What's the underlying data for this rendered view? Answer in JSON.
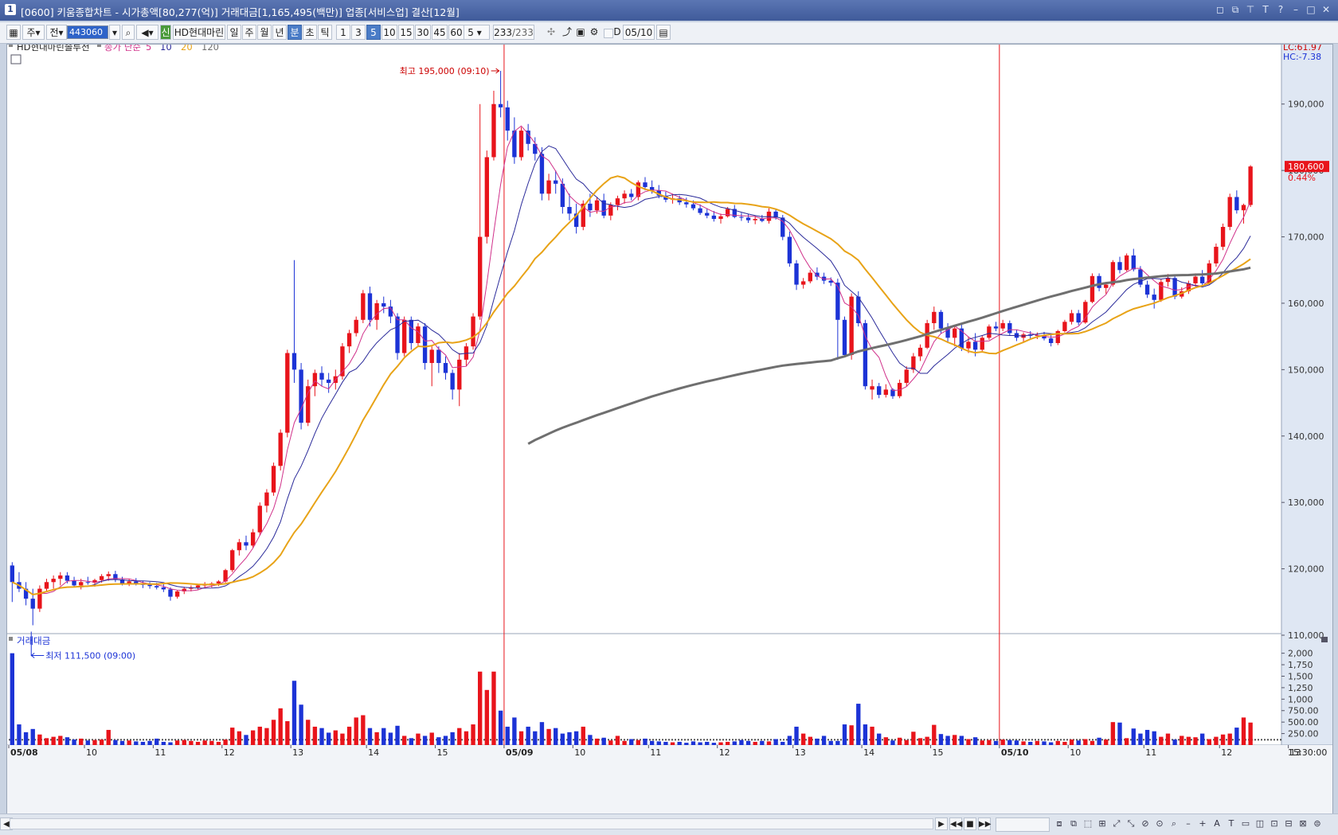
{
  "window": {
    "title": "[0600] 키움종합차트 - 시가총액[80,277(억)] 거래대금[1,165,495(백만)] 업종[서비스업] 결산[12월]",
    "icon_label": "1",
    "controls": [
      "restore-down-icon",
      "restore-icon",
      "pin-icon",
      "font-icon",
      "help-icon",
      "minimize-icon",
      "maximize-icon",
      "close-icon"
    ],
    "control_glyphs": [
      "◻",
      "⧉",
      "⊤",
      "T",
      "?",
      "–",
      "□",
      "✕"
    ]
  },
  "toolbar": {
    "type_select": "주",
    "market_select": "전",
    "code_value": "443060",
    "stock_name": "HD현대마린",
    "periods": [
      "일",
      "주",
      "월",
      "년",
      "분",
      "초",
      "틱"
    ],
    "period_selected": "분",
    "intervals": [
      "1",
      "3",
      "5",
      "10",
      "15",
      "30",
      "45",
      "60"
    ],
    "interval_selected": "5",
    "interval_combo": "5",
    "count_value": "233",
    "count_total": "/233",
    "date_value": "05/10"
  },
  "legend": {
    "stock": "HD현대마린솔루션",
    "ma_prefix": "종가 단순",
    "ma_periods": [
      "5",
      "10",
      "20",
      "120"
    ],
    "ma_colors": [
      "#d0308a",
      "#2a2a9a",
      "#e8a317",
      "#6f6f6f"
    ]
  },
  "indicators": {
    "lc": "LC:61.97",
    "hc": "HC:-7.38"
  },
  "price_tag": {
    "value": "180,600",
    "change": "0.44%"
  },
  "annotations": {
    "high": "최고 195,000 (09:10)",
    "low": "최저 111,500 (09:00)"
  },
  "volume_panel": {
    "label": "거래대금"
  },
  "time_readout": "15:30:00",
  "colors": {
    "up": "#e8141b",
    "down": "#1c33d6",
    "ma5": "#d0308a",
    "ma10": "#2a2a9a",
    "ma20": "#e8a317",
    "ma120": "#6f6f6f",
    "divider": "#e8141b"
  },
  "chart_data": {
    "type": "candlestick",
    "interval": "5분",
    "price_axis_ticks": [
      "190,000",
      "180,000",
      "170,000",
      "160,000",
      "150,000",
      "140,000",
      "130,000",
      "120,000",
      "110,000"
    ],
    "price_ylim": [
      110000,
      198000
    ],
    "volume_axis_ticks": [
      "2,000",
      "1,750",
      "1,500",
      "1,250",
      "1,000",
      "750.00",
      "500.00",
      "250.00"
    ],
    "volume_ylim": [
      0,
      2150
    ],
    "days": [
      "05/08",
      "05/09",
      "05/10"
    ],
    "x_tick_labels": [
      "05/08",
      "10",
      "11",
      "12",
      "13",
      "14",
      "15",
      "05/09",
      "10",
      "11",
      "12",
      "13",
      "14",
      "15",
      "05/10",
      "10",
      "11",
      "12",
      "13",
      "14",
      "15"
    ],
    "x_tick_index": [
      0,
      11,
      21,
      31,
      41,
      52,
      62,
      72,
      82,
      93,
      103,
      114,
      124,
      134,
      144,
      154,
      165,
      176,
      186,
      197,
      207
    ],
    "ohlc": [
      [
        120500,
        121000,
        115000,
        118000
      ],
      [
        118000,
        119500,
        116500,
        117000
      ],
      [
        117000,
        118000,
        114500,
        115500
      ],
      [
        115500,
        117000,
        111500,
        114000
      ],
      [
        114000,
        117500,
        113500,
        117000
      ],
      [
        117000,
        118500,
        116500,
        118000
      ],
      [
        118000,
        119000,
        117000,
        118500
      ],
      [
        118500,
        119500,
        117500,
        119000
      ],
      [
        119000,
        119500,
        117800,
        118200
      ],
      [
        118200,
        118800,
        117200,
        117500
      ],
      [
        117500,
        118500,
        116900,
        118000
      ],
      [
        118000,
        118800,
        117600,
        117900
      ],
      [
        117900,
        118500,
        117300,
        118300
      ],
      [
        118300,
        119200,
        117900,
        118900
      ],
      [
        118900,
        119600,
        118200,
        119200
      ],
      [
        119200,
        119700,
        118000,
        118400
      ],
      [
        118400,
        118800,
        117500,
        117800
      ],
      [
        117800,
        118500,
        117400,
        118100
      ],
      [
        118100,
        118600,
        117500,
        117700
      ],
      [
        117700,
        118200,
        117100,
        117600
      ],
      [
        117600,
        118000,
        117000,
        117400
      ],
      [
        117400,
        117900,
        116900,
        117200
      ],
      [
        117200,
        117700,
        116500,
        116900
      ],
      [
        116900,
        117200,
        115200,
        115800
      ],
      [
        115800,
        116800,
        115500,
        116600
      ],
      [
        116600,
        117300,
        116200,
        117000
      ],
      [
        117000,
        117500,
        116600,
        117200
      ],
      [
        117200,
        117700,
        116900,
        117500
      ],
      [
        117500,
        118000,
        117100,
        117600
      ],
      [
        117600,
        118000,
        117200,
        117800
      ],
      [
        117800,
        118300,
        117400,
        118100
      ],
      [
        118100,
        120000,
        117900,
        119800
      ],
      [
        119800,
        123000,
        119500,
        122800
      ],
      [
        122800,
        124500,
        122000,
        124000
      ],
      [
        124000,
        125000,
        122800,
        123500
      ],
      [
        123500,
        126000,
        123200,
        125500
      ],
      [
        125500,
        130000,
        125000,
        129500
      ],
      [
        129500,
        132000,
        128500,
        131500
      ],
      [
        131500,
        136000,
        131000,
        135500
      ],
      [
        135500,
        141000,
        134800,
        140500
      ],
      [
        140500,
        153000,
        139800,
        152500
      ],
      [
        152500,
        166500,
        148000,
        150000
      ],
      [
        150000,
        151000,
        141000,
        142000
      ],
      [
        142000,
        148500,
        141500,
        147500
      ],
      [
        147500,
        150000,
        146000,
        149500
      ],
      [
        149500,
        150500,
        147500,
        148500
      ],
      [
        148500,
        149500,
        146500,
        148000
      ],
      [
        148000,
        150000,
        147000,
        149000
      ],
      [
        149000,
        154000,
        148500,
        153500
      ],
      [
        153500,
        156000,
        152500,
        155500
      ],
      [
        155500,
        158000,
        155000,
        157500
      ],
      [
        157500,
        162000,
        157000,
        161500
      ],
      [
        161500,
        162500,
        156500,
        157500
      ],
      [
        157500,
        160500,
        156000,
        160000
      ],
      [
        160000,
        161000,
        158500,
        159500
      ],
      [
        159500,
        160500,
        157000,
        158000
      ],
      [
        158000,
        158500,
        151500,
        152500
      ],
      [
        152500,
        158000,
        152000,
        157500
      ],
      [
        157500,
        158000,
        153000,
        154000
      ],
      [
        154000,
        157000,
        153500,
        156500
      ],
      [
        156500,
        157000,
        150000,
        151000
      ],
      [
        151000,
        153500,
        147500,
        153000
      ],
      [
        153000,
        153500,
        149500,
        151000
      ],
      [
        151000,
        152000,
        148500,
        149500
      ],
      [
        149500,
        150000,
        145500,
        147000
      ],
      [
        147000,
        152500,
        144500,
        151500
      ],
      [
        151500,
        154000,
        150500,
        153500
      ],
      [
        153500,
        158500,
        153000,
        158000
      ],
      [
        158000,
        190000,
        157500,
        170000
      ],
      [
        170000,
        183000,
        169000,
        182000
      ],
      [
        182000,
        192000,
        181500,
        190000
      ],
      [
        190000,
        195000,
        188000,
        189500
      ],
      [
        189500,
        190500,
        184500,
        186000
      ],
      [
        186000,
        188000,
        181000,
        182000
      ],
      [
        182000,
        186500,
        181500,
        186000
      ],
      [
        186000,
        187000,
        183000,
        184000
      ],
      [
        184000,
        185000,
        181500,
        182500
      ],
      [
        182500,
        183500,
        175500,
        176500
      ],
      [
        176500,
        179500,
        175500,
        178500
      ],
      [
        178500,
        180000,
        176500,
        178000
      ],
      [
        178000,
        178800,
        173500,
        174500
      ],
      [
        174500,
        176500,
        172500,
        173500
      ],
      [
        173500,
        175000,
        170500,
        171500
      ],
      [
        171500,
        175500,
        171000,
        175000
      ],
      [
        175000,
        176500,
        173000,
        174000
      ],
      [
        174000,
        176000,
        173500,
        175500
      ],
      [
        175500,
        176500,
        172800,
        173200
      ],
      [
        173200,
        175200,
        172500,
        174800
      ],
      [
        174800,
        176200,
        174000,
        175800
      ],
      [
        175800,
        177000,
        175000,
        176500
      ],
      [
        176500,
        177200,
        175500,
        176000
      ],
      [
        176000,
        178500,
        175500,
        178200
      ],
      [
        178200,
        179000,
        177000,
        177500
      ],
      [
        177500,
        178500,
        176500,
        177000
      ],
      [
        177000,
        177800,
        175800,
        176200
      ],
      [
        176200,
        176800,
        175200,
        175600
      ],
      [
        175600,
        176500,
        175000,
        175800
      ],
      [
        175800,
        176200,
        174800,
        175200
      ],
      [
        175200,
        175900,
        174400,
        174900
      ],
      [
        174900,
        175500,
        174000,
        174300
      ],
      [
        174300,
        174900,
        173300,
        173600
      ],
      [
        173600,
        174300,
        172800,
        173200
      ],
      [
        173200,
        173900,
        172300,
        172700
      ],
      [
        172700,
        173500,
        172000,
        173100
      ],
      [
        173100,
        174500,
        172900,
        174200
      ],
      [
        174200,
        174800,
        172800,
        173000
      ],
      [
        173000,
        173600,
        172400,
        172900
      ],
      [
        172900,
        173400,
        172100,
        172500
      ],
      [
        172500,
        173200,
        171900,
        172700
      ],
      [
        172700,
        173300,
        172200,
        172400
      ],
      [
        172400,
        174300,
        172000,
        173800
      ],
      [
        173800,
        174200,
        172600,
        172900
      ],
      [
        172900,
        173300,
        169500,
        170000
      ],
      [
        170000,
        170800,
        165500,
        166000
      ],
      [
        166000,
        166500,
        162000,
        162800
      ],
      [
        162800,
        163800,
        162200,
        163300
      ],
      [
        163300,
        165000,
        163000,
        164600
      ],
      [
        164600,
        165400,
        163500,
        164000
      ],
      [
        164000,
        164600,
        162900,
        163400
      ],
      [
        163400,
        163900,
        162600,
        163100
      ],
      [
        163100,
        163700,
        151500,
        157500
      ],
      [
        157500,
        158000,
        152000,
        152200
      ],
      [
        152200,
        161500,
        151500,
        161000
      ],
      [
        161000,
        161800,
        156500,
        157000
      ],
      [
        157000,
        157500,
        147000,
        147500
      ],
      [
        147000,
        148500,
        145500,
        147500
      ],
      [
        147500,
        148000,
        145700,
        146200
      ],
      [
        146200,
        147800,
        145800,
        147000
      ],
      [
        147000,
        147200,
        145600,
        146000
      ],
      [
        146000,
        148500,
        145700,
        148000
      ],
      [
        148000,
        150500,
        147500,
        150000
      ],
      [
        150000,
        152500,
        149500,
        152000
      ],
      [
        152000,
        153800,
        151300,
        153300
      ],
      [
        153300,
        157500,
        153100,
        157000
      ],
      [
        157000,
        159500,
        156000,
        158700
      ],
      [
        158700,
        159000,
        155500,
        156200
      ],
      [
        156200,
        157000,
        154000,
        154800
      ],
      [
        154800,
        156600,
        153500,
        156200
      ],
      [
        156200,
        157000,
        152800,
        153200
      ],
      [
        153200,
        155000,
        152500,
        154200
      ],
      [
        154200,
        155500,
        152000,
        153000
      ],
      [
        153000,
        155200,
        152800,
        154800
      ],
      [
        154800,
        156800,
        154500,
        156500
      ],
      [
        156500,
        157200,
        155800,
        156200
      ],
      [
        156200,
        157500,
        155800,
        157000
      ],
      [
        157000,
        157400,
        155200,
        155500
      ],
      [
        155500,
        156000,
        154300,
        154800
      ],
      [
        154800,
        155600,
        154200,
        155300
      ],
      [
        155300,
        155800,
        154700,
        155100
      ],
      [
        155100,
        155600,
        154600,
        155200
      ],
      [
        155200,
        155700,
        154400,
        154700
      ],
      [
        154700,
        155300,
        153500,
        154000
      ],
      [
        154000,
        156000,
        153700,
        155800
      ],
      [
        155800,
        157500,
        155600,
        157200
      ],
      [
        157200,
        159000,
        156800,
        158500
      ],
      [
        158500,
        159000,
        156700,
        157100
      ],
      [
        157100,
        160500,
        156900,
        160200
      ],
      [
        160200,
        164500,
        160000,
        164100
      ],
      [
        164100,
        164500,
        161800,
        162300
      ],
      [
        162300,
        163200,
        161400,
        162800
      ],
      [
        162800,
        166500,
        162500,
        166200
      ],
      [
        166200,
        167000,
        164500,
        165000
      ],
      [
        165000,
        167500,
        164800,
        167200
      ],
      [
        167200,
        168200,
        164800,
        165100
      ],
      [
        165100,
        165600,
        162400,
        162800
      ],
      [
        162800,
        163400,
        160800,
        161300
      ],
      [
        161300,
        162200,
        159200,
        160500
      ],
      [
        160500,
        163600,
        160200,
        163200
      ],
      [
        163200,
        164400,
        162500,
        163800
      ],
      [
        163800,
        164300,
        160600,
        161000
      ],
      [
        161000,
        162400,
        160700,
        161800
      ],
      [
        161800,
        163400,
        161400,
        163000
      ],
      [
        163000,
        164500,
        162500,
        164000
      ],
      [
        164000,
        165000,
        162600,
        163000
      ],
      [
        163000,
        166500,
        162800,
        166000
      ],
      [
        166000,
        169000,
        165500,
        168500
      ],
      [
        168500,
        172000,
        168000,
        171500
      ],
      [
        171500,
        176500,
        171000,
        176000
      ],
      [
        176000,
        177000,
        173500,
        174000
      ],
      [
        174000,
        175000,
        172000,
        174800
      ],
      [
        174800,
        180800,
        174500,
        180600
      ]
    ],
    "volume": [
      2000,
      450,
      280,
      350,
      230,
      150,
      180,
      200,
      170,
      120,
      140,
      100,
      110,
      120,
      330,
      110,
      90,
      100,
      80,
      70,
      90,
      140,
      70,
      60,
      100,
      110,
      90,
      70,
      100,
      90,
      70,
      120,
      380,
      300,
      220,
      320,
      400,
      370,
      550,
      800,
      520,
      1400,
      880,
      550,
      400,
      370,
      270,
      320,
      250,
      400,
      600,
      650,
      370,
      280,
      370,
      270,
      420,
      200,
      150,
      250,
      200,
      270,
      170,
      200,
      280,
      370,
      300,
      450,
      1600,
      1200,
      1600,
      750,
      400,
      600,
      300,
      400,
      300,
      500,
      350,
      370,
      250,
      280,
      300,
      400,
      220,
      140,
      160,
      100,
      200,
      90,
      130,
      110,
      140,
      90,
      80,
      70,
      60,
      70,
      50,
      80,
      60,
      70,
      50,
      60,
      70,
      80,
      110,
      90,
      70,
      90,
      80,
      130,
      70,
      200,
      400,
      250,
      180,
      140,
      200,
      90,
      90,
      450,
      430,
      900,
      450,
      400,
      250,
      170,
      100,
      160,
      110,
      290,
      150,
      180,
      440,
      240,
      200,
      220,
      200,
      130,
      170,
      100,
      110,
      90,
      120,
      110,
      100,
      80,
      70,
      90,
      80,
      60,
      90,
      70,
      120,
      100,
      130,
      90,
      160,
      120,
      500,
      490,
      150,
      360,
      250,
      330,
      300,
      180,
      250,
      120,
      200,
      180,
      170,
      250,
      130,
      180,
      230,
      250,
      380,
      600,
      490,
      480,
      650,
      460
    ]
  }
}
